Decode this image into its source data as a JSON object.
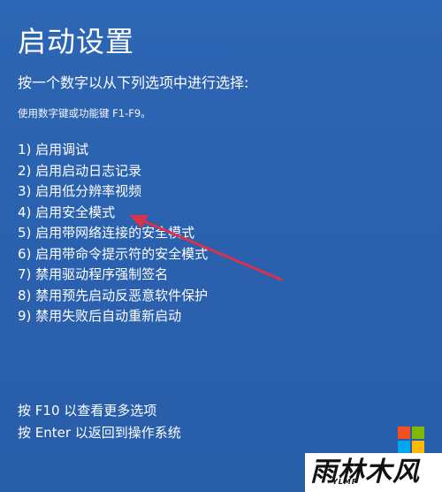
{
  "screen": {
    "title": "启动设置",
    "prompt": "按一个数字以从下列选项中进行选择:",
    "hint": "使用数字键或功能键 F1-F9。"
  },
  "options": [
    "1) 启用调试",
    "2) 启用启动日志记录",
    "3) 启用低分辨率视频",
    "4) 启用安全模式",
    "5) 启用带网络连接的安全模式",
    "6) 启用带命令提示符的安全模式",
    "7) 禁用驱动程序强制签名",
    "8) 禁用预先启动反恶意软件保护",
    "9) 禁用失败后自动重新启动"
  ],
  "footer": {
    "more": "按 F10 以查看更多选项",
    "back": "按 Enter 以返回到操作系统"
  },
  "watermark": {
    "text": "雨林木风",
    "sub": "YLMF"
  },
  "colors": {
    "background": "#2b63b0",
    "text": "#ffffff",
    "arrow": "#d9324a"
  }
}
